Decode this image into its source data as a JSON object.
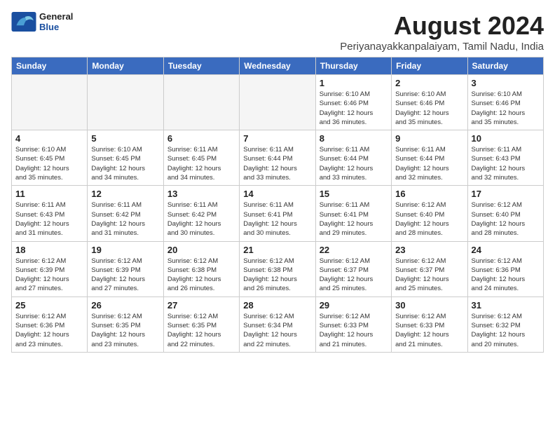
{
  "header": {
    "logo_line1": "General",
    "logo_line2": "Blue",
    "month_title": "August 2024",
    "location": "Periyanayakkanpalaiyam, Tamil Nadu, India"
  },
  "weekdays": [
    "Sunday",
    "Monday",
    "Tuesday",
    "Wednesday",
    "Thursday",
    "Friday",
    "Saturday"
  ],
  "weeks": [
    [
      {
        "day": "",
        "info": ""
      },
      {
        "day": "",
        "info": ""
      },
      {
        "day": "",
        "info": ""
      },
      {
        "day": "",
        "info": ""
      },
      {
        "day": "1",
        "info": "Sunrise: 6:10 AM\nSunset: 6:46 PM\nDaylight: 12 hours\nand 36 minutes."
      },
      {
        "day": "2",
        "info": "Sunrise: 6:10 AM\nSunset: 6:46 PM\nDaylight: 12 hours\nand 35 minutes."
      },
      {
        "day": "3",
        "info": "Sunrise: 6:10 AM\nSunset: 6:46 PM\nDaylight: 12 hours\nand 35 minutes."
      }
    ],
    [
      {
        "day": "4",
        "info": "Sunrise: 6:10 AM\nSunset: 6:45 PM\nDaylight: 12 hours\nand 35 minutes."
      },
      {
        "day": "5",
        "info": "Sunrise: 6:10 AM\nSunset: 6:45 PM\nDaylight: 12 hours\nand 34 minutes."
      },
      {
        "day": "6",
        "info": "Sunrise: 6:11 AM\nSunset: 6:45 PM\nDaylight: 12 hours\nand 34 minutes."
      },
      {
        "day": "7",
        "info": "Sunrise: 6:11 AM\nSunset: 6:44 PM\nDaylight: 12 hours\nand 33 minutes."
      },
      {
        "day": "8",
        "info": "Sunrise: 6:11 AM\nSunset: 6:44 PM\nDaylight: 12 hours\nand 33 minutes."
      },
      {
        "day": "9",
        "info": "Sunrise: 6:11 AM\nSunset: 6:44 PM\nDaylight: 12 hours\nand 32 minutes."
      },
      {
        "day": "10",
        "info": "Sunrise: 6:11 AM\nSunset: 6:43 PM\nDaylight: 12 hours\nand 32 minutes."
      }
    ],
    [
      {
        "day": "11",
        "info": "Sunrise: 6:11 AM\nSunset: 6:43 PM\nDaylight: 12 hours\nand 31 minutes."
      },
      {
        "day": "12",
        "info": "Sunrise: 6:11 AM\nSunset: 6:42 PM\nDaylight: 12 hours\nand 31 minutes."
      },
      {
        "day": "13",
        "info": "Sunrise: 6:11 AM\nSunset: 6:42 PM\nDaylight: 12 hours\nand 30 minutes."
      },
      {
        "day": "14",
        "info": "Sunrise: 6:11 AM\nSunset: 6:41 PM\nDaylight: 12 hours\nand 30 minutes."
      },
      {
        "day": "15",
        "info": "Sunrise: 6:11 AM\nSunset: 6:41 PM\nDaylight: 12 hours\nand 29 minutes."
      },
      {
        "day": "16",
        "info": "Sunrise: 6:12 AM\nSunset: 6:40 PM\nDaylight: 12 hours\nand 28 minutes."
      },
      {
        "day": "17",
        "info": "Sunrise: 6:12 AM\nSunset: 6:40 PM\nDaylight: 12 hours\nand 28 minutes."
      }
    ],
    [
      {
        "day": "18",
        "info": "Sunrise: 6:12 AM\nSunset: 6:39 PM\nDaylight: 12 hours\nand 27 minutes."
      },
      {
        "day": "19",
        "info": "Sunrise: 6:12 AM\nSunset: 6:39 PM\nDaylight: 12 hours\nand 27 minutes."
      },
      {
        "day": "20",
        "info": "Sunrise: 6:12 AM\nSunset: 6:38 PM\nDaylight: 12 hours\nand 26 minutes."
      },
      {
        "day": "21",
        "info": "Sunrise: 6:12 AM\nSunset: 6:38 PM\nDaylight: 12 hours\nand 26 minutes."
      },
      {
        "day": "22",
        "info": "Sunrise: 6:12 AM\nSunset: 6:37 PM\nDaylight: 12 hours\nand 25 minutes."
      },
      {
        "day": "23",
        "info": "Sunrise: 6:12 AM\nSunset: 6:37 PM\nDaylight: 12 hours\nand 25 minutes."
      },
      {
        "day": "24",
        "info": "Sunrise: 6:12 AM\nSunset: 6:36 PM\nDaylight: 12 hours\nand 24 minutes."
      }
    ],
    [
      {
        "day": "25",
        "info": "Sunrise: 6:12 AM\nSunset: 6:36 PM\nDaylight: 12 hours\nand 23 minutes."
      },
      {
        "day": "26",
        "info": "Sunrise: 6:12 AM\nSunset: 6:35 PM\nDaylight: 12 hours\nand 23 minutes."
      },
      {
        "day": "27",
        "info": "Sunrise: 6:12 AM\nSunset: 6:35 PM\nDaylight: 12 hours\nand 22 minutes."
      },
      {
        "day": "28",
        "info": "Sunrise: 6:12 AM\nSunset: 6:34 PM\nDaylight: 12 hours\nand 22 minutes."
      },
      {
        "day": "29",
        "info": "Sunrise: 6:12 AM\nSunset: 6:33 PM\nDaylight: 12 hours\nand 21 minutes."
      },
      {
        "day": "30",
        "info": "Sunrise: 6:12 AM\nSunset: 6:33 PM\nDaylight: 12 hours\nand 21 minutes."
      },
      {
        "day": "31",
        "info": "Sunrise: 6:12 AM\nSunset: 6:32 PM\nDaylight: 12 hours\nand 20 minutes."
      }
    ]
  ]
}
